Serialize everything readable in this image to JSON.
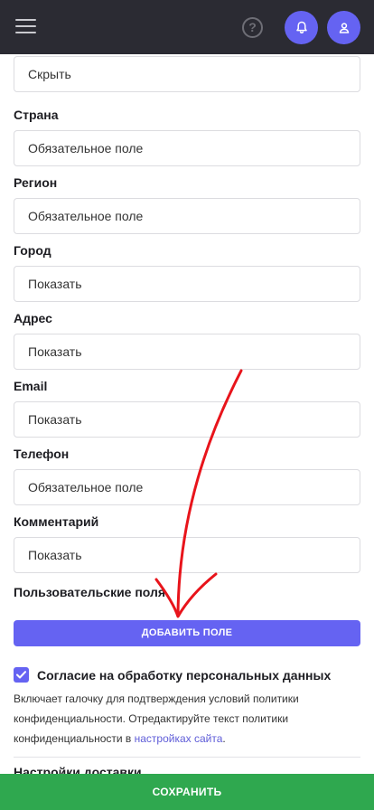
{
  "header": {
    "menu_icon": "hamburger-icon",
    "help_icon": "question-circle-icon",
    "help_glyph": "?",
    "bell_icon": "bell-icon",
    "user_icon": "user-icon"
  },
  "fields": {
    "first": {
      "value": "Скрыть"
    },
    "items": [
      {
        "label": "Страна",
        "value": "Обязательное поле"
      },
      {
        "label": "Регион",
        "value": "Обязательное поле"
      },
      {
        "label": "Город",
        "value": "Показать"
      },
      {
        "label": "Адрес",
        "value": "Показать"
      },
      {
        "label": "Email",
        "value": "Показать"
      },
      {
        "label": "Телефон",
        "value": "Обязательное поле"
      },
      {
        "label": "Комментарий",
        "value": "Показать"
      }
    ]
  },
  "custom_fields": {
    "title": "Пользовательские поля",
    "add_button": "ДОБАВИТЬ ПОЛЕ"
  },
  "consent": {
    "checked": true,
    "label": "Согласие на обработку персональных данных",
    "description": "Включает галочку для подтверждения условий политики конфиденциальности. Отредактируйте текст политики конфиденциальности в ",
    "link_text": "настройках сайта",
    "description_end": "."
  },
  "delivery": {
    "title": "Настройки доставки"
  },
  "footer": {
    "save_label": "СОХРАНИТЬ"
  },
  "colors": {
    "accent": "#6563f2",
    "save": "#2fa84f",
    "header": "#2b2b33",
    "arrow": "#e8141b"
  }
}
